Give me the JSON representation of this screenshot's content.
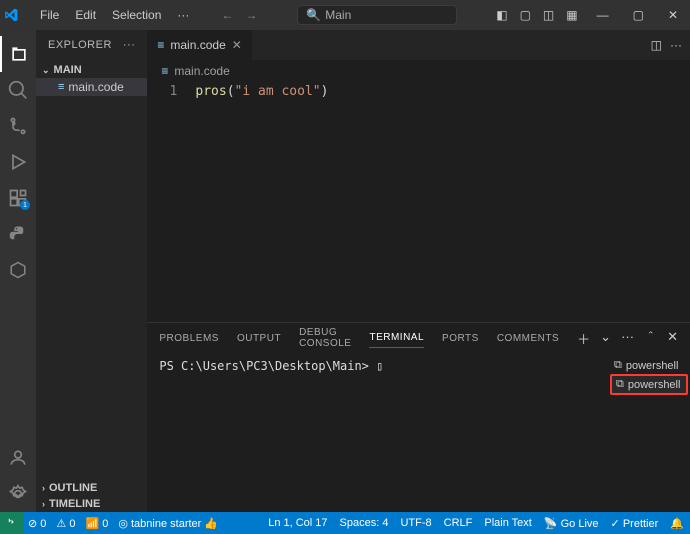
{
  "titlebar": {
    "menu": [
      "File",
      "Edit",
      "Selection"
    ],
    "ellipsis": "···",
    "search_text": "Main"
  },
  "sidebar": {
    "title": "EXPLORER",
    "ellipsis": "···",
    "main_section": "MAIN",
    "file": "main.code",
    "outline": "OUTLINE",
    "timeline": "TIMELINE"
  },
  "editor": {
    "tab_label": "main.code",
    "breadcrumb": "main.code",
    "line_no": "1",
    "code_fn": "pros",
    "code_open": "(",
    "code_str": "\"i am cool\"",
    "code_close": ")"
  },
  "panel": {
    "tabs": {
      "problems": "PROBLEMS",
      "output": "OUTPUT",
      "debug": "DEBUG CONSOLE",
      "terminal": "TERMINAL",
      "ports": "PORTS",
      "comments": "COMMENTS"
    },
    "prompt": "PS C:\\Users\\PC3\\Desktop\\Main>",
    "terminals": [
      "powershell",
      "powershell"
    ]
  },
  "statusbar": {
    "errors": "0",
    "warnings": "0",
    "radio": "0",
    "tabnine": "tabnine starter",
    "position": "Ln 1, Col 17",
    "spaces": "Spaces: 4",
    "encoding": "UTF-8",
    "eol": "CRLF",
    "lang": "Plain Text",
    "golive": "Go Live",
    "prettier": "Prettier"
  }
}
